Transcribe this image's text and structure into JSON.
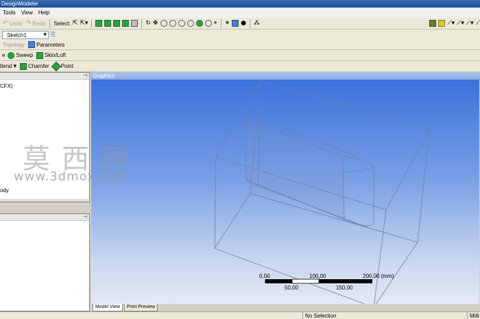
{
  "app": {
    "title": "DesignModeler"
  },
  "menu": [
    "Tools",
    "View",
    "Help"
  ],
  "toolbar1": {
    "undo_label": "Undo",
    "redo_label": "Redo",
    "select_label": "Select:"
  },
  "toolbar2": {
    "sketch_value": "Sketch1"
  },
  "toolbar3": {
    "topology_label": "Topology",
    "parameters_label": "Parameters"
  },
  "toolbar4": {
    "partial_label": "e",
    "sweep_label": "Sweep",
    "skinloft_label": "Skin/Loft"
  },
  "toolbar5": {
    "blend_label": "Blend",
    "chamfer_label": "Chamfer",
    "point_label": "Point"
  },
  "tree": {
    "item1": "CFX)",
    "item2": "ody"
  },
  "graphics": {
    "title": "Graphics"
  },
  "scale": {
    "top_labels": [
      "0,00",
      "100,00",
      "200,00 (mm)"
    ],
    "bottom_labels": [
      "50,00",
      "150,00"
    ]
  },
  "tabs": [
    "Model View",
    "Print Preview"
  ],
  "status": {
    "selection": "No Selection",
    "units": "Milli"
  },
  "watermark": {
    "cn": "莫西网",
    "url": "www.3dmox.com"
  }
}
